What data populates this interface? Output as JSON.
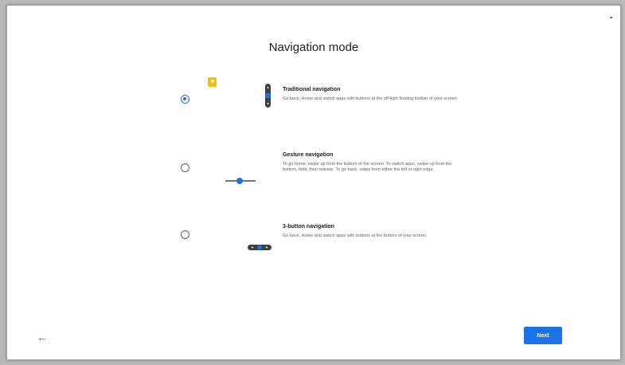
{
  "page": {
    "title": "Navigation mode"
  },
  "options": [
    {
      "title": "Traditional navigation",
      "description": "Go back, Home and switch apps with buttons at the off-light floating toolbar of your screen",
      "selected": true,
      "icon": "floating-toolbar-illustration"
    },
    {
      "title": "Gesture navigation",
      "description": "To go home, swipe up from the bottom of the screen. To switch apps, swipe up from the bottom, hold, then release. To go back, swipe from either the left or right edge.",
      "selected": false,
      "icon": "gesture-bar-illustration"
    },
    {
      "title": "3-button navigation",
      "description": "Go back, Home and switch apps with buttons at the bottom of your screen.",
      "selected": false,
      "icon": "three-button-bar-illustration"
    }
  ],
  "footer": {
    "back_icon": "←",
    "next_label": "Next"
  },
  "colors": {
    "accent": "#1a73e8",
    "badge": "#fbbc04"
  }
}
